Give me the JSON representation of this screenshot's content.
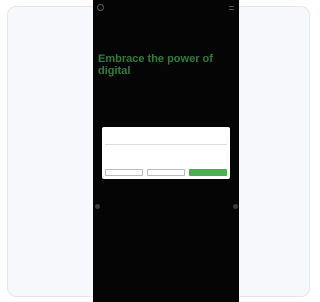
{
  "hero": {
    "title": "Embrace the power of digital",
    "subtitle": "",
    "footer": ""
  },
  "cookie_dialog": {
    "brand": "",
    "partner": "",
    "tabs": [
      "",
      "",
      ""
    ],
    "heading": "",
    "body": "",
    "buttons": {
      "deny": "",
      "customize": "",
      "allow": ""
    }
  },
  "colors": {
    "accent": "#2e7d3e",
    "button_green": "#4caf50",
    "phone_bg": "#050505",
    "card_bg": "#f6f8fb"
  },
  "icons": [
    "logo-icon",
    "menu-icon",
    "arrow-left-icon",
    "arrow-right-icon"
  ]
}
